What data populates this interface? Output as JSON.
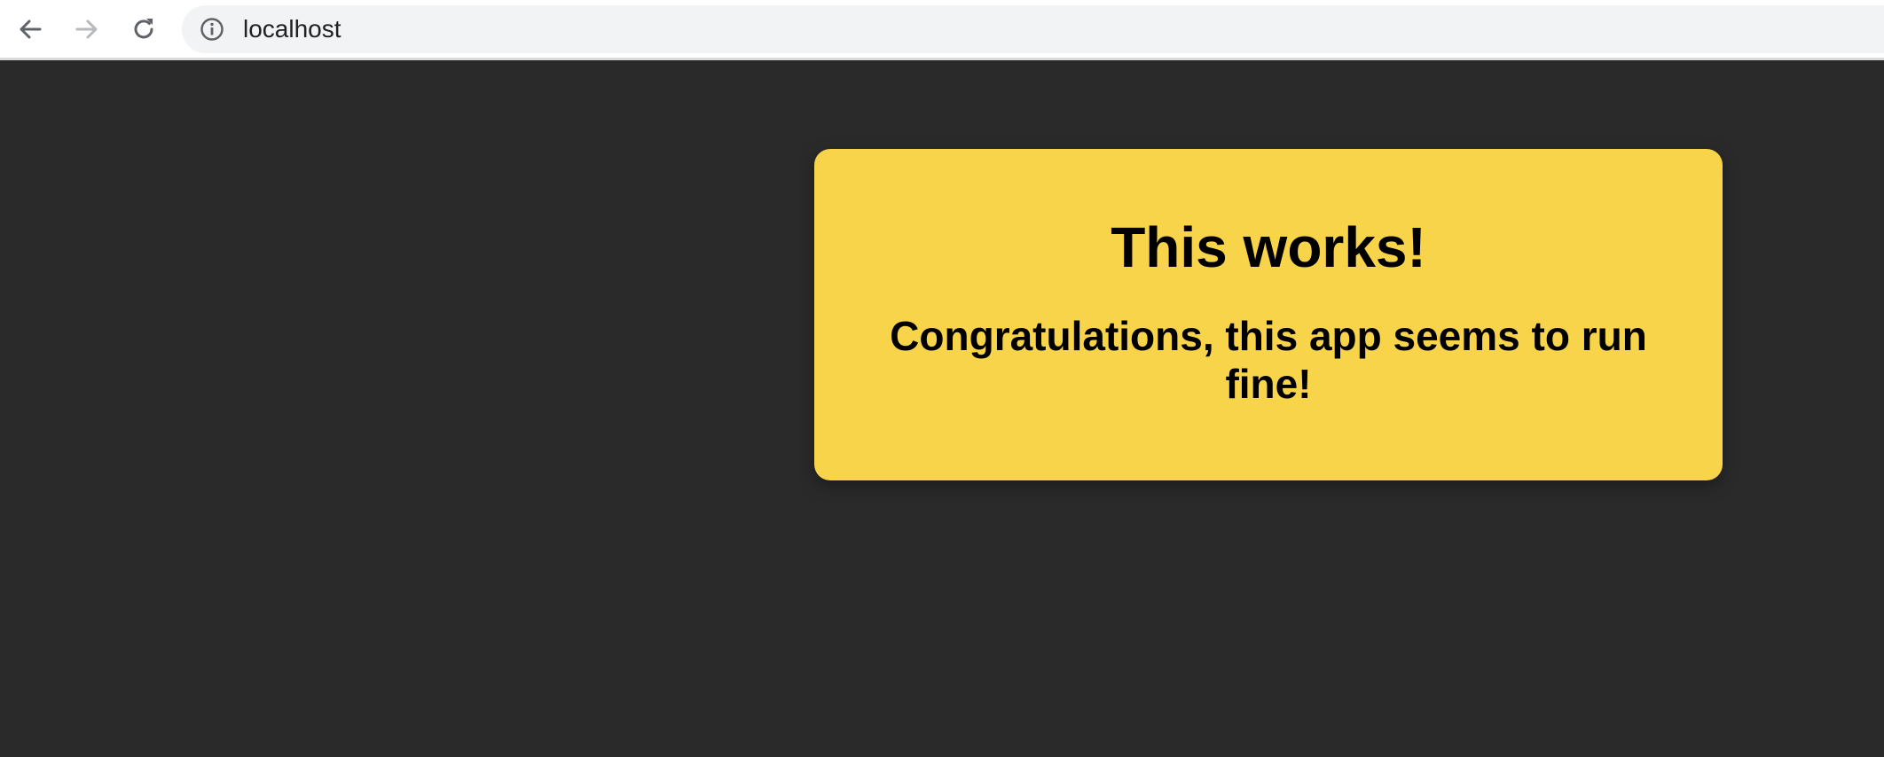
{
  "browser": {
    "url": "localhost",
    "icons": {
      "back": "arrow-left-icon",
      "forward": "arrow-right-icon",
      "reload": "reload-icon",
      "site_info": "info-circle-icon"
    }
  },
  "page": {
    "background_color": "#2a2a2a",
    "card": {
      "title": "This works!",
      "message": "Congratulations, this app seems to run fine!",
      "background_color": "#f7d44a"
    }
  }
}
